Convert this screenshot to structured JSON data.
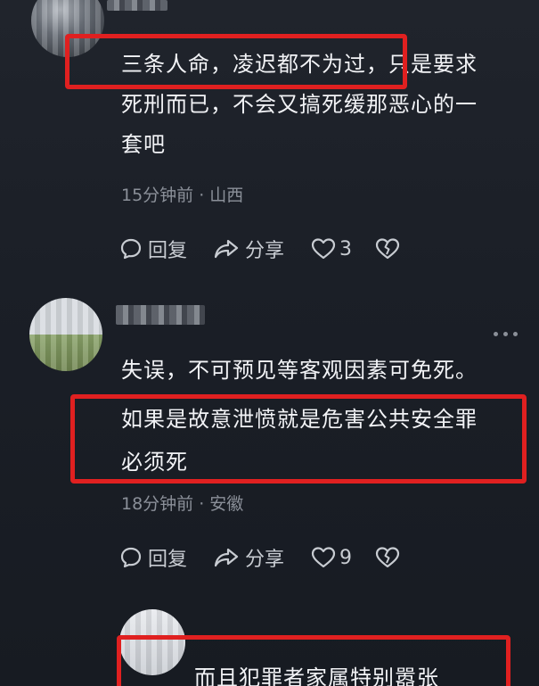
{
  "comments": [
    {
      "lines": [
        "三条人命，凌迟都不为过，只是要求",
        "死刑而已，不会又搞死缓那恶心的一",
        "套吧"
      ],
      "meta": "15分钟前 · 山西",
      "reply_label": "回复",
      "share_label": "分享",
      "like_count": "3"
    },
    {
      "lines": [
        "失误，不可预见等客观因素可免死。",
        "如果是故意泄愤就是危害公共安全罪",
        "必须死"
      ],
      "meta": "18分钟前 · 安徽",
      "reply_label": "回复",
      "share_label": "分享",
      "like_count": "9"
    },
    {
      "lines": [
        "而且犯罪者家属特别嚣张"
      ]
    }
  ],
  "colors": {
    "highlight": "#e02020",
    "background": "#1b1f27",
    "meta_text": "#8b9099"
  },
  "icons": [
    "comment-icon",
    "share-arrow-icon",
    "heart-icon",
    "broken-heart-icon",
    "more-dots-icon"
  ]
}
